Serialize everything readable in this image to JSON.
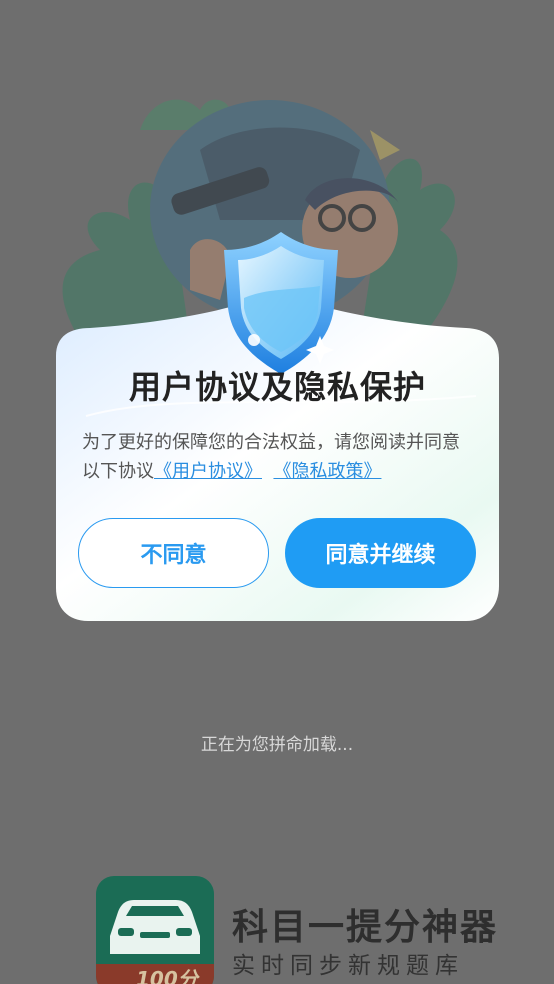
{
  "dialog": {
    "title": "用户协议及隐私保护",
    "body_text": "为了更好的保障您的合法权益，请您阅读并同意以下协议",
    "link_user_agreement": "《用户协议》",
    "link_privacy_policy": "《隐私政策》",
    "decline_label": "不同意",
    "accept_label": "同意并继续"
  },
  "loading": {
    "text": "正在为您拼命加载..."
  },
  "brand": {
    "name": "科目一提分神器",
    "slogan": "实时同步新规题库",
    "logo_badge": "100分"
  },
  "colors": {
    "overlay": "#6e6e6e",
    "accent": "#1f9cf4",
    "link": "#2a8ee0"
  }
}
